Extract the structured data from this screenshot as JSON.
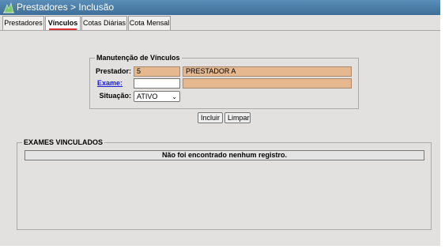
{
  "app": {
    "title": "Prestadores > Inclusão"
  },
  "tabs": [
    {
      "label": "Prestadores"
    },
    {
      "label": "Vínculos"
    },
    {
      "label": "Cotas Diárias"
    },
    {
      "label": "Cota Mensal"
    }
  ],
  "form": {
    "legend": "Manutenção de Vínculos",
    "prestador": {
      "label": "Prestador:",
      "code": "5",
      "name": "PRESTADOR A"
    },
    "exame": {
      "label": "Exame:",
      "code": "",
      "name": ""
    },
    "situacao": {
      "label": "Situação:",
      "selected": "ATIVO"
    }
  },
  "buttons": {
    "incluir": "Incluir",
    "limpar": "Limpar"
  },
  "results": {
    "legend": "EXAMES VINCULADOS",
    "empty_message": "Não foi encontrado nenhum registro."
  },
  "colors": {
    "titlebar": "#4a7ea8",
    "readonly_field": "#e6b88f",
    "link": "#1a1ad6",
    "background": "#e3e1df"
  }
}
